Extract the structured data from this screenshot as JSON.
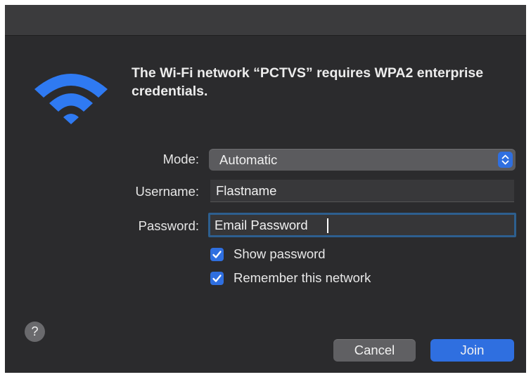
{
  "dialog": {
    "heading": "The Wi-Fi network “PCTVS” requires WPA2 enterprise credentials.",
    "icon": "wifi-icon"
  },
  "form": {
    "mode_label": "Mode:",
    "mode_value": "Automatic",
    "username_label": "Username:",
    "username_value": "Flastname",
    "password_label": "Password:",
    "password_value": "Email Password"
  },
  "options": {
    "show_password_label": "Show password",
    "show_password_checked": true,
    "remember_label": "Remember this network",
    "remember_checked": true
  },
  "buttons": {
    "help": "?",
    "cancel": "Cancel",
    "join": "Join"
  },
  "colors": {
    "accent": "#2f6fe0",
    "window_bg": "#2b2b2d",
    "focus_ring": "#2d5f8f"
  }
}
